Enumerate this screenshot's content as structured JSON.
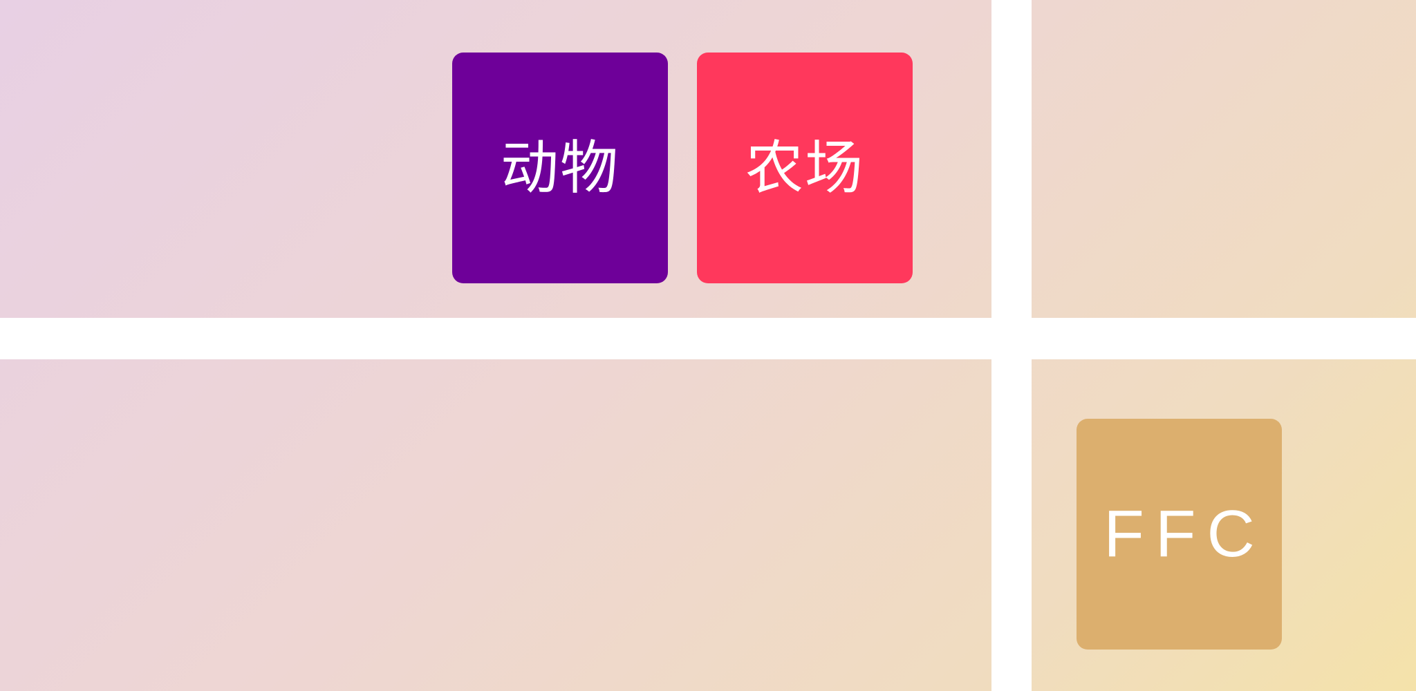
{
  "tiles": {
    "animal": {
      "label": "动物",
      "color": "#6e0099"
    },
    "farm": {
      "label": "农场",
      "color": "#ff385c"
    },
    "ffc": {
      "label": "FFC",
      "color": "#dcaf6e"
    }
  },
  "background": {
    "gradient_colors": [
      "#e8d0e4",
      "#eed6d3",
      "#f0dcc0",
      "#f4e2aa"
    ],
    "divider_color": "#ffffff"
  }
}
